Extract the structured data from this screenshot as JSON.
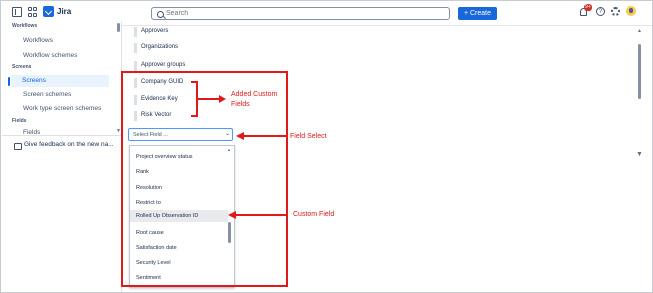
{
  "app": {
    "name": "Jira"
  },
  "search": {
    "placeholder": "Search"
  },
  "header": {
    "create_label": "+ Create",
    "notification_badge": "9+",
    "help_label": "?"
  },
  "sidebar": {
    "sections": [
      {
        "label": "Workflows",
        "items": [
          "Workflows",
          "Workflow schemes"
        ]
      },
      {
        "label": "Screens",
        "items": [
          "Screens",
          "Screen schemes",
          "Work type screen schemes"
        ]
      },
      {
        "label": "Fields",
        "items": [
          "Fields"
        ]
      }
    ],
    "active_item": "Screens",
    "feedback_label": "Give feedback on the new na..."
  },
  "fields_list": [
    "Approvers",
    "Organizations",
    "Approver groups",
    "Company GUID",
    "Evidence Key",
    "Risk Vector"
  ],
  "field_select": {
    "value": "Select Field ..."
  },
  "dropdown_options": [
    "Project overview status",
    "Rank",
    "Resolution",
    "Restrict to",
    "Rolled Up Observation ID",
    "Root cause",
    "Satisfaction date",
    "Security Level",
    "Sentiment"
  ],
  "highlighted_option": "Rolled Up Observation ID",
  "annotations": {
    "added_custom_fields": [
      "Added Custom",
      "Fields"
    ],
    "field_select": "Field Select",
    "custom_field": "Custom Field"
  },
  "colors": {
    "annotation": "#e0191b",
    "primary": "#1868db",
    "active_nav": "#e9f2ff"
  },
  "icons": [
    "sidebar-toggle-icon",
    "app-switcher-icon",
    "jira-logo-icon",
    "search-icon",
    "bell-icon",
    "help-icon",
    "gear-icon",
    "avatar",
    "feedback-icon",
    "chevron-down-icon"
  ]
}
